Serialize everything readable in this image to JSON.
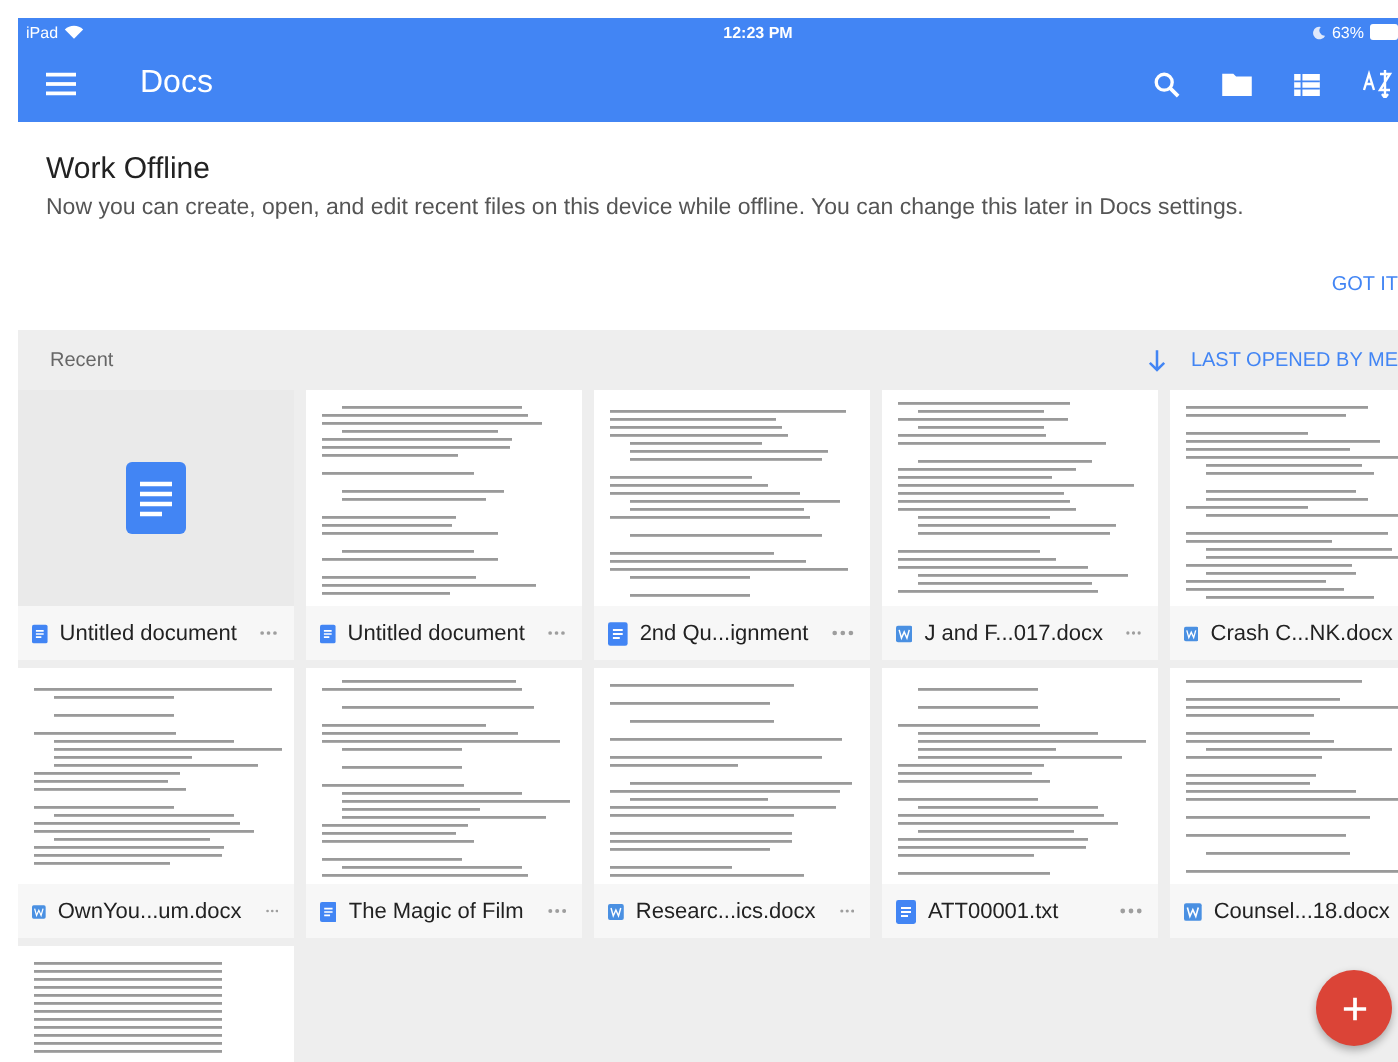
{
  "status_bar": {
    "carrier": "iPad",
    "time": "12:23 PM",
    "battery": "63%"
  },
  "toolbar": {
    "title": "Docs"
  },
  "banner": {
    "title": "Work Offline",
    "text": "Now you can create, open, and edit recent files on this device while offline. You can change this later in Docs settings.",
    "button": "GOT IT"
  },
  "section": {
    "label": "Recent",
    "sort": "LAST OPENED BY ME"
  },
  "files": [
    {
      "name": "Untitled document",
      "kind": "doc",
      "has_preview": false
    },
    {
      "name": "Untitled document",
      "kind": "doc",
      "has_preview": true
    },
    {
      "name": "2nd Qu...ignment",
      "kind": "doc",
      "has_preview": true
    },
    {
      "name": "J and F...017.docx",
      "kind": "word",
      "has_preview": true
    },
    {
      "name": "Crash C...NK.docx",
      "kind": "word",
      "has_preview": true
    },
    {
      "name": "OwnYou...um.docx",
      "kind": "word",
      "has_preview": true
    },
    {
      "name": "The Magic of Film",
      "kind": "doc",
      "has_preview": true
    },
    {
      "name": "Researc...ics.docx",
      "kind": "word",
      "has_preview": true
    },
    {
      "name": "ATT00001.txt",
      "kind": "doc",
      "has_preview": true
    },
    {
      "name": "Counsel...18.docx",
      "kind": "word",
      "has_preview": true
    }
  ]
}
